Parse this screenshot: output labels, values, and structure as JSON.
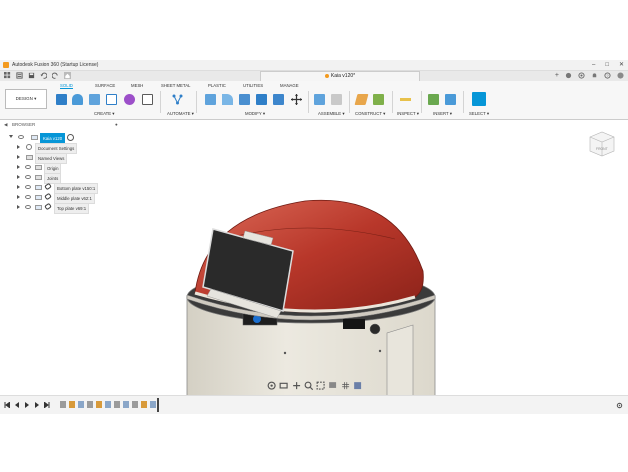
{
  "window": {
    "title": "Autodesk Fusion 360 (Startup License)"
  },
  "document_tab": {
    "label": "Kaia v120*"
  },
  "toolbar": {
    "design_button": "DESIGN ▾",
    "workspace_tabs": [
      "SOLID",
      "SURFACE",
      "MESH",
      "SHEET METAL",
      "PLASTIC",
      "UTILITIES",
      "MANAGE"
    ],
    "active_tab": "SOLID",
    "groups": [
      "CREATE ▾",
      "AUTOMATE ▾",
      "MODIFY ▾",
      "ASSEMBLE ▾",
      "CONSTRUCT ▾",
      "INSPECT ▾",
      "INSERT ▾",
      "SELECT ▾"
    ]
  },
  "browser": {
    "title": "BROWSER",
    "root": "Kaia v120",
    "items": [
      {
        "label": "Document Settings",
        "type": "settings"
      },
      {
        "label": "Named Views",
        "type": "folder"
      },
      {
        "label": "Origin",
        "type": "folder"
      },
      {
        "label": "Joints",
        "type": "folder"
      },
      {
        "label": "Bottom plate v150:1",
        "type": "component"
      },
      {
        "label": "Middle plate v62:1",
        "type": "component"
      },
      {
        "label": "Top plate v69:1",
        "type": "component"
      }
    ]
  },
  "viewcube": {
    "label": "FRONT"
  },
  "colors": {
    "accent": "#0696d7",
    "dome": "#b8372a",
    "body": "#e6e3da",
    "brand": "#f39a1e"
  }
}
